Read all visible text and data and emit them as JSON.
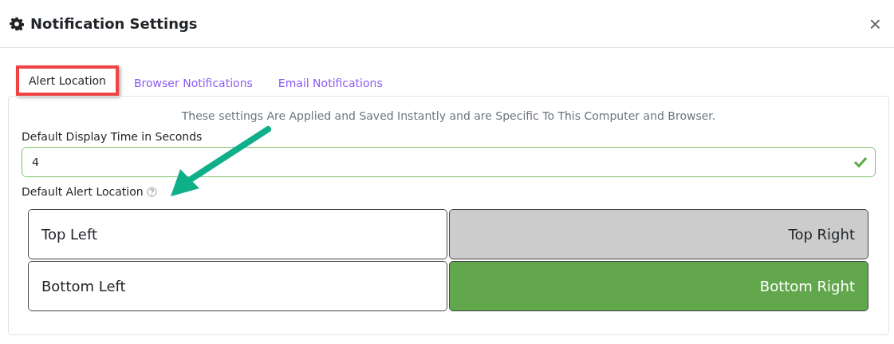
{
  "window": {
    "title": "Notification Settings",
    "close": "×"
  },
  "tabs": [
    {
      "label": "Alert Location",
      "selected": true,
      "outlined": true
    },
    {
      "label": "Browser Notifications",
      "selected": false,
      "outlined": false
    },
    {
      "label": "Email Notifications",
      "selected": false,
      "outlined": false
    }
  ],
  "notice": "These settings Are Applied and Saved Instantly and are Specific To This Computer and Browser.",
  "display_time": {
    "label": "Default Display Time in Seconds",
    "value": "4",
    "valid": true
  },
  "alert_location": {
    "label": "Default Alert Location",
    "help": true,
    "callout_arrow": true,
    "options": [
      {
        "label": "Top Left",
        "selected": false,
        "hovered": false
      },
      {
        "label": "Top Right",
        "selected": false,
        "hovered": true
      },
      {
        "label": "Bottom Left",
        "selected": false,
        "hovered": false
      },
      {
        "label": "Bottom Right",
        "selected": true,
        "hovered": false
      }
    ]
  }
}
